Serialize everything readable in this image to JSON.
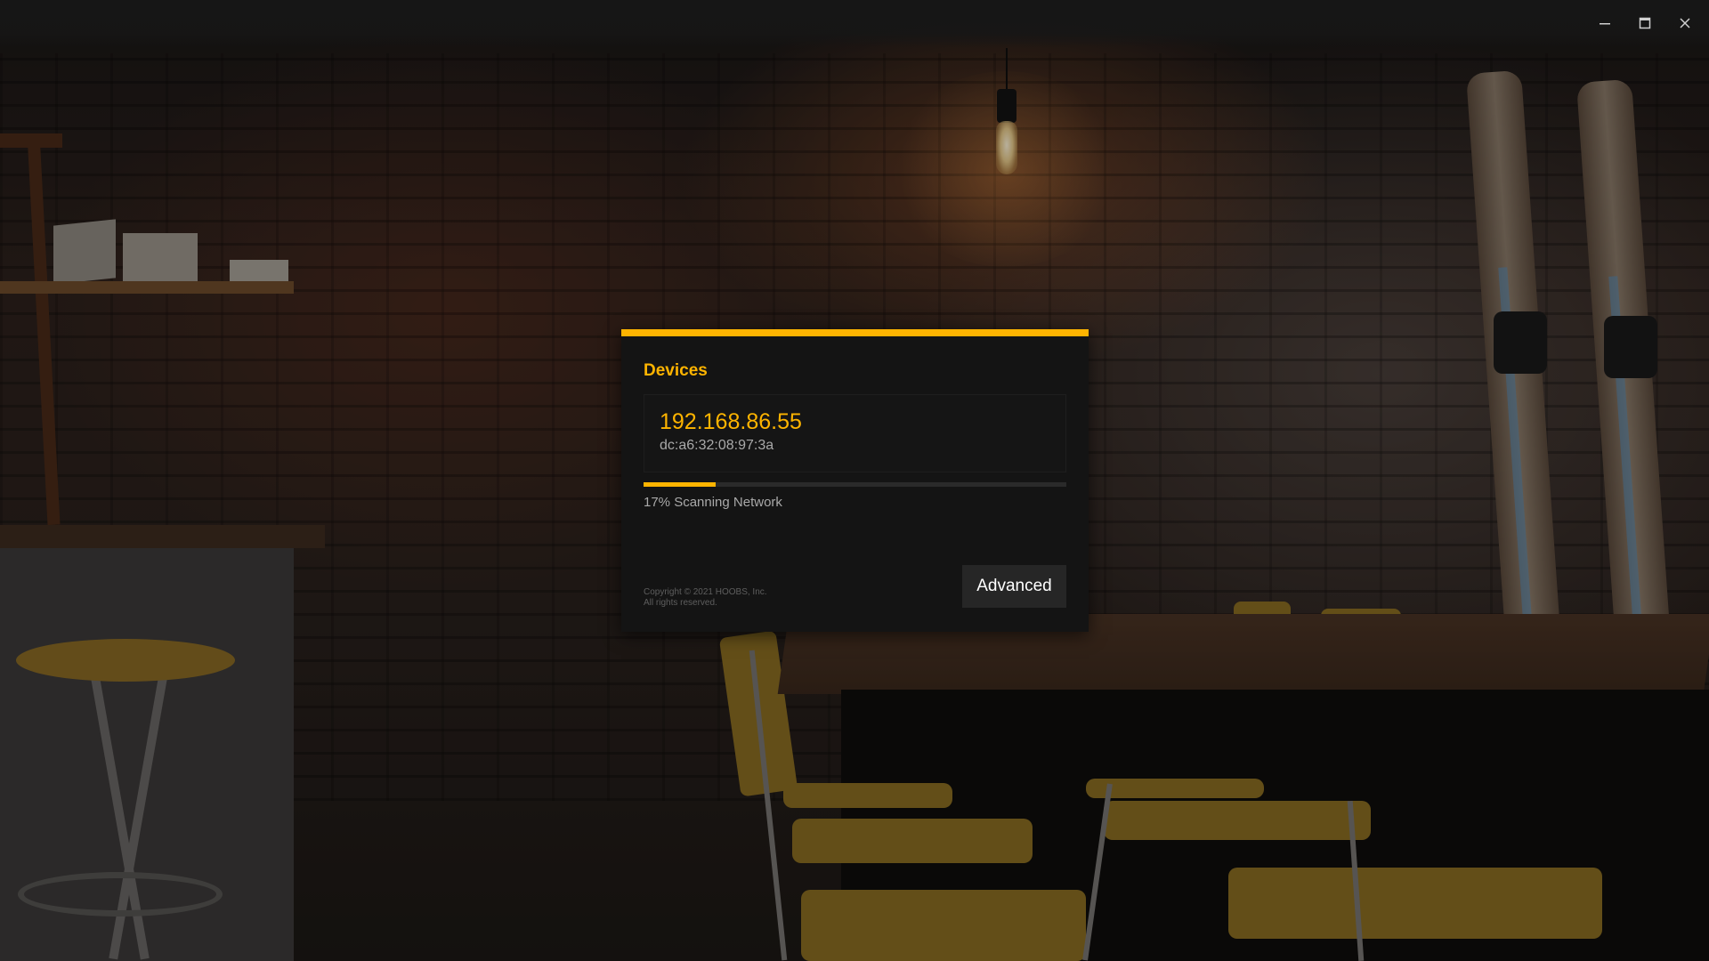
{
  "window": {
    "controls": [
      {
        "name": "minimize",
        "icon": "minimize-icon"
      },
      {
        "name": "maximize",
        "icon": "maximize-icon"
      },
      {
        "name": "close",
        "icon": "close-icon"
      }
    ]
  },
  "dialog": {
    "title": "Devices",
    "accent_color": "#feb400",
    "devices": [
      {
        "ip": "192.168.86.55",
        "mac": "dc:a6:32:08:97:3a"
      }
    ],
    "progress": {
      "percent": 17,
      "label": "17% Scanning Network"
    },
    "copyright_line1": "Copyright © 2021 HOOBS, Inc.",
    "copyright_line2": "All rights reserved.",
    "advanced_label": "Advanced"
  }
}
